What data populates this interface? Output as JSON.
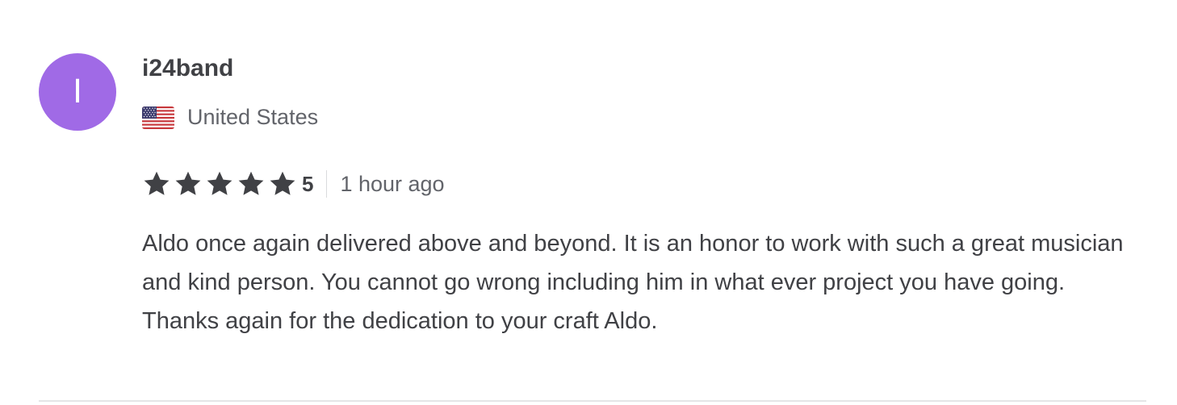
{
  "review": {
    "avatar_letter": "I",
    "avatar_color": "#a06ae6",
    "username": "i24band",
    "country": {
      "flag_icon": "us-flag-icon",
      "name": "United States"
    },
    "rating": {
      "stars_filled": 5,
      "stars_total": 5,
      "value": "5"
    },
    "time_ago": "1 hour ago",
    "text": "Aldo once again delivered above and beyond. It is an honor to work with such a great musician and kind person. You cannot go wrong including him in what ever project you have going. Thanks again for the dedication to your craft Aldo."
  }
}
